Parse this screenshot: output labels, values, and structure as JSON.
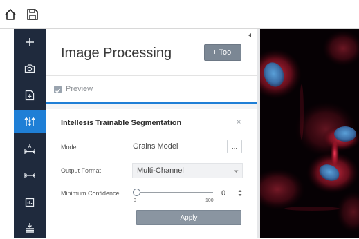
{
  "topbar": {
    "home_icon": "home-icon",
    "save_icon": "save-icon"
  },
  "sidebar": {
    "items": [
      {
        "icon": "plus-icon",
        "active": false
      },
      {
        "icon": "camera-icon",
        "active": false
      },
      {
        "icon": "import-document-icon",
        "active": false
      },
      {
        "icon": "adjust-arrows-icon",
        "active": true
      },
      {
        "icon": "measure-annotation-icon",
        "active": false
      },
      {
        "icon": "measure-width-icon",
        "active": false
      },
      {
        "icon": "chart-icon",
        "active": false
      },
      {
        "icon": "stack-layers-icon",
        "active": false
      }
    ]
  },
  "panel": {
    "title": "Image Processing",
    "tool_button": "+ Tool",
    "preview_label": "Preview",
    "preview_checked": true
  },
  "tool_card": {
    "title": "Intellesis Trainable Segmentation",
    "close_label": "×",
    "model_label": "Model",
    "model_value": "Grains Model",
    "model_button": "...",
    "output_label": "Output Format",
    "output_value": "Multi-Channel",
    "confidence_label": "Minimum Confidence",
    "slider_min": "0",
    "slider_max": "100",
    "confidence_value": "0",
    "apply_label": "Apply"
  },
  "colors": {
    "sidebar_bg": "#1f2a3d",
    "accent": "#1f7fd6",
    "button_gray": "#7b8794"
  }
}
